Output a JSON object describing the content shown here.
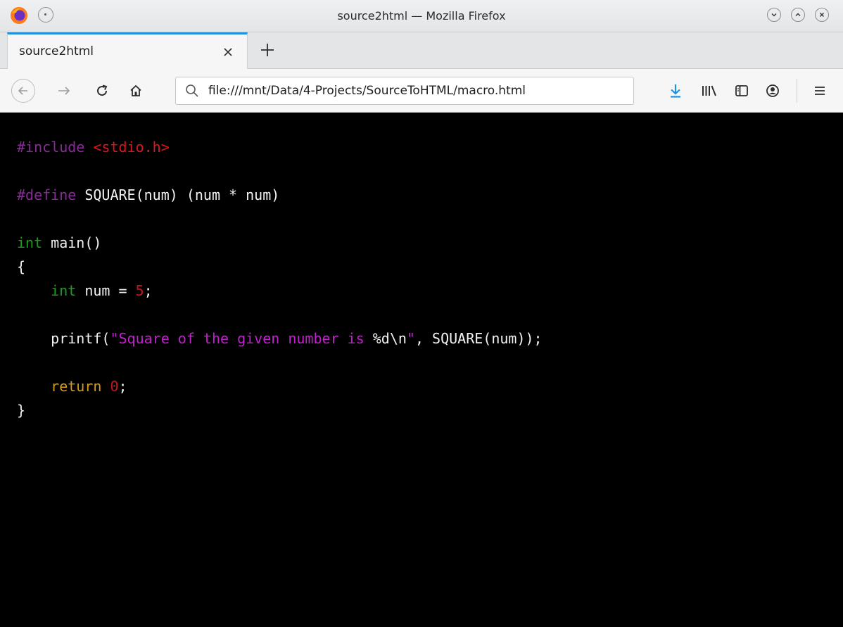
{
  "window": {
    "title": "source2html — Mozilla Firefox"
  },
  "tabs": [
    {
      "label": "source2html",
      "active": true
    }
  ],
  "navbar": {
    "url": "file:///mnt/Data/4-Projects/SourceToHTML/macro.html"
  },
  "icons": {
    "app": "firefox-icon",
    "pin": "pin-icon",
    "minimize": "chevron-down-icon",
    "maximize": "chevron-up-icon",
    "close": "close-icon",
    "back": "back-arrow-icon",
    "forward": "forward-arrow-icon",
    "reload": "reload-icon",
    "home": "home-icon",
    "search": "search-icon",
    "downloads": "download-icon",
    "library": "library-icon",
    "sidebar": "sidebar-icon",
    "account": "account-icon",
    "menu": "hamburger-menu-icon"
  },
  "colors": {
    "preprocessor": "#8a2a9a",
    "include_target": "#e0141c",
    "type": "#16a01e",
    "number": "#c8141c",
    "string": "#c31fd0",
    "keyword": "#d69a1a",
    "text": "#f2f2f2",
    "accent": "#1e90e0"
  },
  "code": {
    "l1_pp": "#include",
    "l1_target": "<stdio.h>",
    "l3_pp": "#define",
    "l3_rest": "SQUARE(num) (num * num)",
    "l5_type": "int",
    "l5_rest": "main()",
    "l6": "{",
    "l7_type": "int",
    "l7_mid": "num = ",
    "l7_num": "5",
    "l7_end": ";",
    "l9_start": "printf(",
    "l9_str": "\"Square of the given number is ",
    "l9_fmt": "%d\\n",
    "l9_strend": "\"",
    "l9_end": ", SQUARE(num));",
    "l11_kw": "return",
    "l11_num": "0",
    "l11_end": ";",
    "l12": "}"
  }
}
